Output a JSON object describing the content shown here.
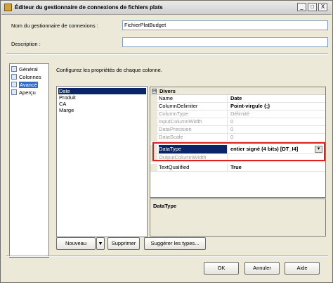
{
  "window": {
    "title": "Éditeur du gestionnaire de connexions de fichiers plats"
  },
  "title_buttons": {
    "minimize": "_",
    "maximize": "□",
    "close": "X"
  },
  "form": {
    "name_label": "Nom du gestionnaire de connexions :",
    "name_value": "FichierPlatBudget",
    "description_label": "Description :",
    "description_value": ""
  },
  "nav": {
    "items": [
      {
        "label": "Général",
        "icon": "general-icon"
      },
      {
        "label": "Colonnes",
        "icon": "columns-icon"
      },
      {
        "label": "Avancé",
        "icon": "advanced-icon",
        "selected": true
      },
      {
        "label": "Aperçu",
        "icon": "preview-icon"
      }
    ]
  },
  "main": {
    "instructions": "Configurez les propriétés de chaque colonne."
  },
  "columns": {
    "items": [
      {
        "label": "Date",
        "selected": true
      },
      {
        "label": "Produit"
      },
      {
        "label": "CA"
      },
      {
        "label": "Marge"
      }
    ]
  },
  "properties": {
    "category": "Divers",
    "toggle": "⊟",
    "rows": [
      {
        "name": "Name",
        "value": "Date",
        "state": "bold"
      },
      {
        "name": "ColumnDelimiter",
        "value": "Point-virgule {;}",
        "state": "bold"
      },
      {
        "name": "ColumnType",
        "value": "Délimité",
        "state": "dim"
      },
      {
        "name": "InputColumnWidth",
        "value": "0",
        "state": "dim"
      },
      {
        "name": "DataPrecision",
        "value": "0",
        "state": "dim"
      },
      {
        "name": "DataScale",
        "value": "0",
        "state": "dim"
      },
      {
        "name": "DataType",
        "value": "entier signé (4 bits) [DT_I4]",
        "state": "selected"
      },
      {
        "name": "OutputColumnWidth",
        "value": "",
        "state": "dim"
      },
      {
        "name": "TextQualified",
        "value": "True",
        "state": "bold"
      }
    ],
    "description_title": "DataType",
    "dropdown_glyph": "▾"
  },
  "buttons": {
    "new": "Nouveau",
    "new_dropdown": "▾",
    "delete": "Supprimer",
    "suggest": "Suggérer les types...",
    "ok": "OK",
    "cancel": "Annuler",
    "help": "Aide"
  },
  "colors": {
    "selection": "#0a246a",
    "highlight_box": "#e02020",
    "nav_selection": "#316ac5"
  }
}
